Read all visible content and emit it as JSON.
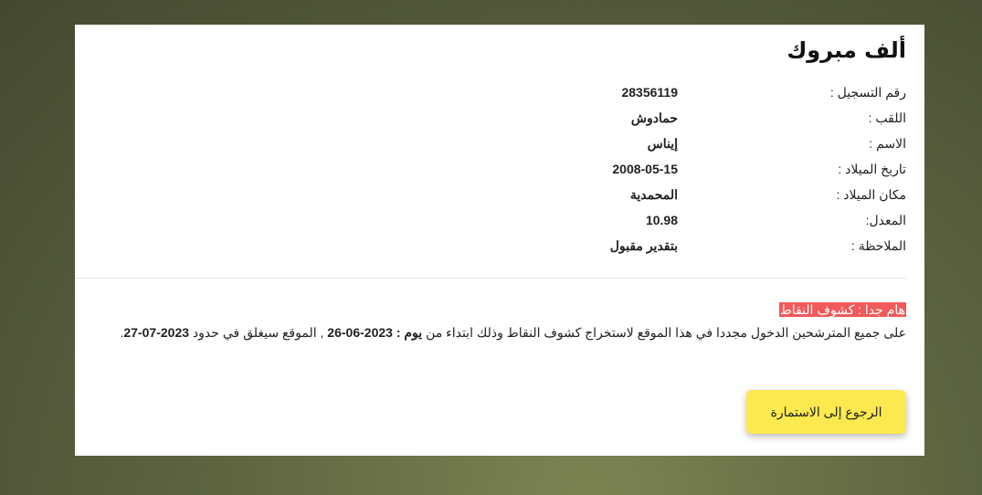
{
  "title": "ألف مبروك",
  "info": [
    {
      "label": "رقم التسجيل :",
      "value": "28356119"
    },
    {
      "label": "اللقب :",
      "value": "حمادوش"
    },
    {
      "label": "الاسم :",
      "value": "إيناس"
    },
    {
      "label": "تاريخ الميلاد :",
      "value": "2008-05-15"
    },
    {
      "label": "مكان الميلاد :",
      "value": "المحمدية"
    },
    {
      "label": "المعدل:",
      "value": "10.98"
    },
    {
      "label": "الملاحظة :",
      "value": "بتقدير مقبول"
    }
  ],
  "notice": {
    "alert": "هام جدا : كشوف النقاط",
    "text_part1": "على جميع المترشحين الدخول مجددا في هذا الموقع لاستخراج كشوف النقاط وذلك ابتداء من ",
    "day_label": "يوم : ",
    "start_date": "2023-06-26",
    "text_part2": " , الموقع سيغلق في حدود ",
    "end_date": "2023-07-27",
    "end_punct": "."
  },
  "back_button_label": "الرجوع إلى الاستمارة"
}
